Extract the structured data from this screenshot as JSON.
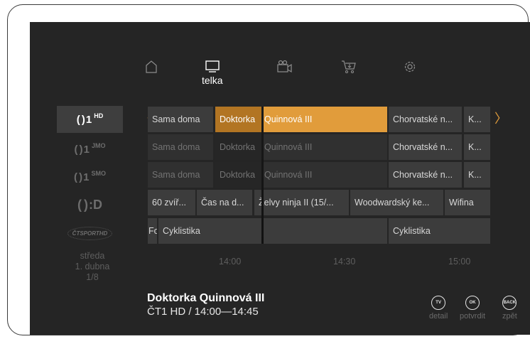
{
  "nav": {
    "items": [
      {
        "icon": "home-icon"
      },
      {
        "icon": "tv-icon",
        "label": "telka"
      },
      {
        "icon": "camera-icon"
      },
      {
        "icon": "cart-icon"
      },
      {
        "icon": "gear-icon"
      }
    ]
  },
  "channels": [
    {
      "name": "ČT1 HD",
      "mark": "1",
      "sup": "HD"
    },
    {
      "name": "ČT1 JMO",
      "mark": "1",
      "sup": "JMO"
    },
    {
      "name": "ČT1 SMO",
      "mark": "1",
      "sup": "SMO"
    },
    {
      "name": "ČT :D",
      "mark": ":D",
      "sup": ""
    },
    {
      "name": "ČT sport HD",
      "logo": "ČTSPORTHD"
    }
  ],
  "grid": {
    "row0": [
      "Sama doma",
      "Doktorka ",
      "Quinnová III",
      "Chorvatské n...",
      "K..."
    ],
    "row1": [
      "Sama doma",
      "Doktorka ",
      "Quinnová III",
      "Chorvatské n...",
      "K..."
    ],
    "row2": [
      "Sama doma",
      "Doktorka ",
      "Quinnová III",
      "Chorvatské n...",
      "K..."
    ],
    "row3": [
      "60 zvíř...",
      "Čas na d...",
      "Želvy ninja II (15/...",
      "Woodwardský ke...",
      "Wifina"
    ],
    "row4": [
      "Fo",
      "Cyklistika",
      "",
      "Cyklistika"
    ]
  },
  "timeline": {
    "date_line1": "středa",
    "date_line2": "1. dubna",
    "date_line3": "1/8",
    "times": [
      "14:00",
      "14:30",
      "15:00"
    ]
  },
  "selected": {
    "title": "Doktorka Quinnová III",
    "subtitle": "ČT1 HD / 14:00—14:45"
  },
  "hints": [
    {
      "key": "TV",
      "label": "detail"
    },
    {
      "key": "OK",
      "label": "potvrdit"
    },
    {
      "key": "BACK",
      "label": "zpět"
    }
  ],
  "colors": {
    "accent": "#e19c3b",
    "background": "#252525"
  }
}
